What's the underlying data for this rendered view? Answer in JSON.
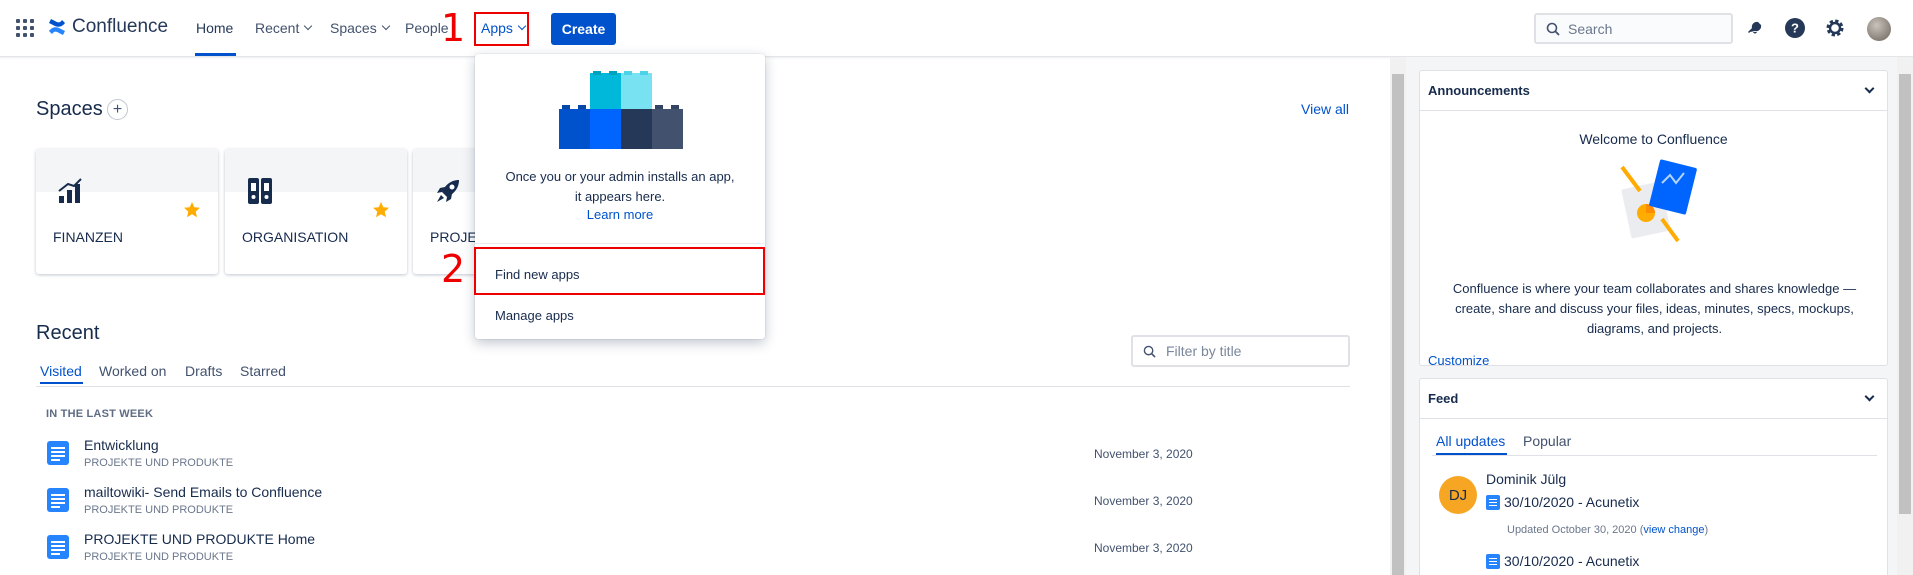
{
  "nav": {
    "logo_text": "Confluence",
    "home": "Home",
    "recent": "Recent",
    "spaces": "Spaces",
    "people": "People",
    "apps": "Apps",
    "create": "Create",
    "search_placeholder": "Search"
  },
  "annotations": {
    "step1": "1",
    "step2": "2",
    "color": "#ee0000"
  },
  "spaces": {
    "title": "Spaces",
    "add": "+",
    "view_all": "View all",
    "cards": [
      {
        "name": "FINANZEN",
        "icon": "bar-chart-icon",
        "starred": true
      },
      {
        "name": "ORGANISATION",
        "icon": "binders-icon",
        "starred": true
      },
      {
        "name": "PROJEKT",
        "icon": "rocket-icon",
        "starred": false
      }
    ]
  },
  "recent": {
    "title": "Recent",
    "tabs": [
      "Visited",
      "Worked on",
      "Drafts",
      "Starred"
    ],
    "filter_placeholder": "Filter by title",
    "group_label": "IN THE LAST WEEK",
    "items": [
      {
        "title": "Entwicklung",
        "space": "PROJEKTE UND PRODUKTE",
        "date": "November 3, 2020"
      },
      {
        "title": "mailtowiki- Send Emails to Confluence",
        "space": "PROJEKTE UND PRODUKTE",
        "date": "November 3, 2020"
      },
      {
        "title": "PROJEKTE UND PRODUKTE Home",
        "space": "PROJEKTE UND PRODUKTE",
        "date": "November 3, 2020"
      }
    ]
  },
  "apps_dropdown": {
    "message_line1": "Once you or your admin installs an app,",
    "message_line2": "it appears here.",
    "learn_more": "Learn more",
    "find_new_apps": "Find new apps",
    "manage_apps": "Manage apps"
  },
  "announcements": {
    "header": "Announcements",
    "title": "Welcome to Confluence",
    "body": "Confluence is where your team collaborates and shares knowledge — create, share and discuss your files, ideas, minutes, specs, mockups, diagrams, and projects.",
    "customize": "Customize"
  },
  "feed": {
    "header": "Feed",
    "tabs": [
      "All updates",
      "Popular"
    ],
    "entry": {
      "initials": "DJ",
      "name": "Dominik Jülg",
      "page": "30/10/2020 - Acunetix",
      "updated": "Updated October 30, 2020 (",
      "view_change": "view change",
      "updated_close": ")",
      "page2": "30/10/2020 - Acunetix"
    }
  },
  "colors": {
    "accent": "#0052cc",
    "star": "#ffab00",
    "avatar": "#f7a623"
  }
}
